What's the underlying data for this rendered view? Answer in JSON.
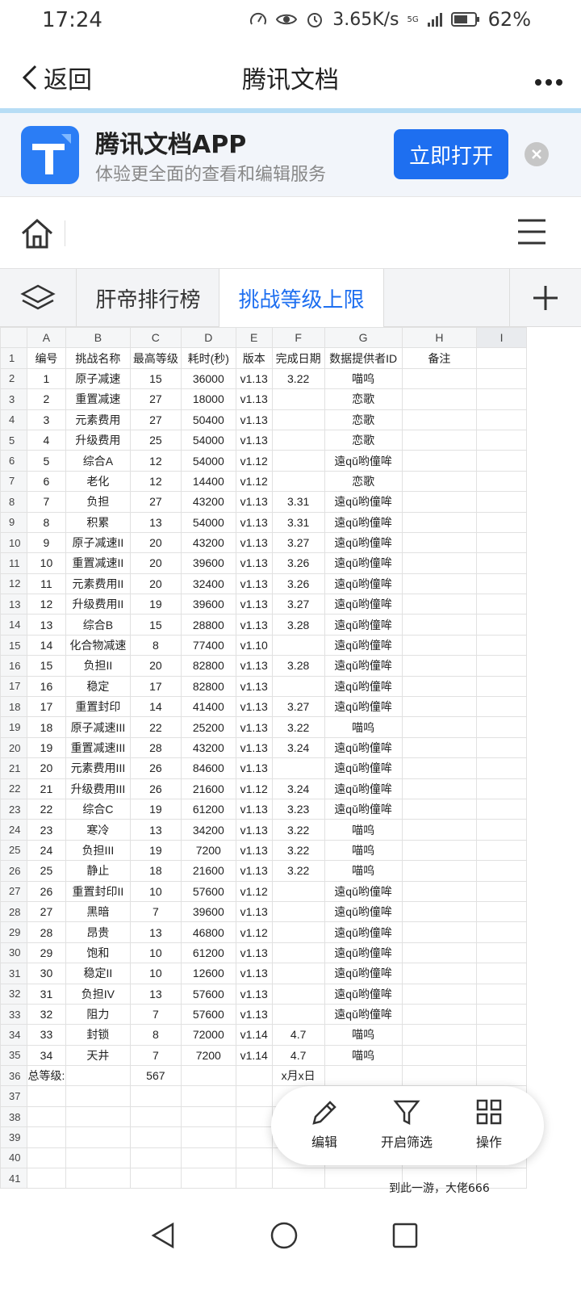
{
  "status": {
    "time": "17:24",
    "net_speed": "3.65K/s",
    "signal": "5G",
    "battery": "62%"
  },
  "nav": {
    "back_label": "返回",
    "title": "腾讯文档"
  },
  "promo": {
    "title": "腾讯文档APP",
    "subtitle": "体验更全面的查看和编辑服务",
    "open_label": "立即打开"
  },
  "sheet_tabs": [
    {
      "label": "肝帝排行榜"
    },
    {
      "label": "挑战等级上限",
      "active": true
    }
  ],
  "grid": {
    "columns": [
      "A",
      "B",
      "C",
      "D",
      "E",
      "F",
      "G",
      "H",
      "I"
    ],
    "rows": [
      [
        "编号",
        "挑战名称",
        "最高等级",
        "耗时(秒)",
        "版本",
        "完成日期",
        "数据提供者ID",
        "备注",
        ""
      ],
      [
        "1",
        "原子减速",
        "15",
        "36000",
        "v1.13",
        "3.22",
        "喵呜",
        "",
        ""
      ],
      [
        "2",
        "重置减速",
        "27",
        "18000",
        "v1.13",
        "",
        "恋歌",
        "",
        ""
      ],
      [
        "3",
        "元素费用",
        "27",
        "50400",
        "v1.13",
        "",
        "恋歌",
        "",
        ""
      ],
      [
        "4",
        "升级费用",
        "25",
        "54000",
        "v1.13",
        "",
        "恋歌",
        "",
        ""
      ],
      [
        "5",
        "综合A",
        "12",
        "54000",
        "v1.12",
        "",
        "遠qǔ哟僮哞",
        "",
        ""
      ],
      [
        "6",
        "老化",
        "12",
        "14400",
        "v1.12",
        "",
        "恋歌",
        "",
        ""
      ],
      [
        "7",
        "负担",
        "27",
        "43200",
        "v1.13",
        "3.31",
        "遠qǔ哟僮哞",
        "",
        ""
      ],
      [
        "8",
        "积累",
        "13",
        "54000",
        "v1.13",
        "3.31",
        "遠qǔ哟僮哞",
        "",
        ""
      ],
      [
        "9",
        "原子减速II",
        "20",
        "43200",
        "v1.13",
        "3.27",
        "遠qǔ哟僮哞",
        "",
        ""
      ],
      [
        "10",
        "重置减速II",
        "20",
        "39600",
        "v1.13",
        "3.26",
        "遠qǔ哟僮哞",
        "",
        ""
      ],
      [
        "11",
        "元素费用II",
        "20",
        "32400",
        "v1.13",
        "3.26",
        "遠qǔ哟僮哞",
        "",
        ""
      ],
      [
        "12",
        "升级费用II",
        "19",
        "39600",
        "v1.13",
        "3.27",
        "遠qǔ哟僮哞",
        "",
        ""
      ],
      [
        "13",
        "综合B",
        "15",
        "28800",
        "v1.13",
        "3.28",
        "遠qǔ哟僮哞",
        "",
        ""
      ],
      [
        "14",
        "化合物减速",
        "8",
        "77400",
        "v1.10",
        "",
        "遠qǔ哟僮哞",
        "",
        ""
      ],
      [
        "15",
        "负担II",
        "20",
        "82800",
        "v1.13",
        "3.28",
        "遠qǔ哟僮哞",
        "",
        ""
      ],
      [
        "16",
        "稳定",
        "17",
        "82800",
        "v1.13",
        "",
        "遠qǔ哟僮哞",
        "",
        ""
      ],
      [
        "17",
        "重置封印",
        "14",
        "41400",
        "v1.13",
        "3.27",
        "遠qǔ哟僮哞",
        "",
        ""
      ],
      [
        "18",
        "原子减速III",
        "22",
        "25200",
        "v1.13",
        "3.22",
        "喵呜",
        "",
        ""
      ],
      [
        "19",
        "重置减速III",
        "28",
        "43200",
        "v1.13",
        "3.24",
        "遠qǔ哟僮哞",
        "",
        ""
      ],
      [
        "20",
        "元素费用III",
        "26",
        "84600",
        "v1.13",
        "",
        "遠qǔ哟僮哞",
        "",
        ""
      ],
      [
        "21",
        "升级费用III",
        "26",
        "21600",
        "v1.12",
        "3.24",
        "遠qǔ哟僮哞",
        "",
        ""
      ],
      [
        "22",
        "综合C",
        "19",
        "61200",
        "v1.13",
        "3.23",
        "遠qǔ哟僮哞",
        "",
        ""
      ],
      [
        "23",
        "寒冷",
        "13",
        "34200",
        "v1.13",
        "3.22",
        "喵呜",
        "",
        ""
      ],
      [
        "24",
        "负担III",
        "19",
        "7200",
        "v1.13",
        "3.22",
        "喵呜",
        "",
        ""
      ],
      [
        "25",
        "静止",
        "18",
        "21600",
        "v1.13",
        "3.22",
        "喵呜",
        "",
        ""
      ],
      [
        "26",
        "重置封印II",
        "10",
        "57600",
        "v1.12",
        "",
        "遠qǔ哟僮哞",
        "",
        ""
      ],
      [
        "27",
        "黑暗",
        "7",
        "39600",
        "v1.13",
        "",
        "遠qǔ哟僮哞",
        "",
        ""
      ],
      [
        "28",
        "昂贵",
        "13",
        "46800",
        "v1.12",
        "",
        "遠qǔ哟僮哞",
        "",
        ""
      ],
      [
        "29",
        "饱和",
        "10",
        "61200",
        "v1.13",
        "",
        "遠qǔ哟僮哞",
        "",
        ""
      ],
      [
        "30",
        "稳定II",
        "10",
        "12600",
        "v1.13",
        "",
        "遠qǔ哟僮哞",
        "",
        ""
      ],
      [
        "31",
        "负担IV",
        "13",
        "57600",
        "v1.13",
        "",
        "遠qǔ哟僮哞",
        "",
        ""
      ],
      [
        "32",
        "阻力",
        "7",
        "57600",
        "v1.13",
        "",
        "遠qǔ哟僮哞",
        "",
        ""
      ],
      [
        "33",
        "封锁",
        "8",
        "72000",
        "v1.14",
        "4.7",
        "喵呜",
        "",
        ""
      ],
      [
        "34",
        "天井",
        "7",
        "7200",
        "v1.14",
        "4.7",
        "喵呜",
        "",
        ""
      ],
      [
        "总等级:",
        "",
        "567",
        "",
        "",
        "x月x日",
        "",
        "",
        ""
      ],
      [
        "",
        "",
        "",
        "",
        "",
        "",
        "",
        "",
        ""
      ],
      [
        "",
        "",
        "",
        "",
        "",
        "",
        "",
        "",
        ""
      ],
      [
        "",
        "",
        "",
        "",
        "",
        "",
        "",
        "",
        ""
      ],
      [
        "",
        "",
        "",
        "",
        "",
        "",
        "",
        "",
        ""
      ],
      [
        "",
        "",
        "",
        "",
        "",
        "",
        "",
        "",
        ""
      ]
    ]
  },
  "fab": {
    "edit_label": "编辑",
    "filter_label": "开启筛选",
    "ops_label": "操作"
  },
  "footer_note": "到此一游，大佬666",
  "colors": {
    "accent": "#1e6ff0",
    "promo_bg": "#f2f5fa",
    "header_bg": "#f5f6f7"
  }
}
